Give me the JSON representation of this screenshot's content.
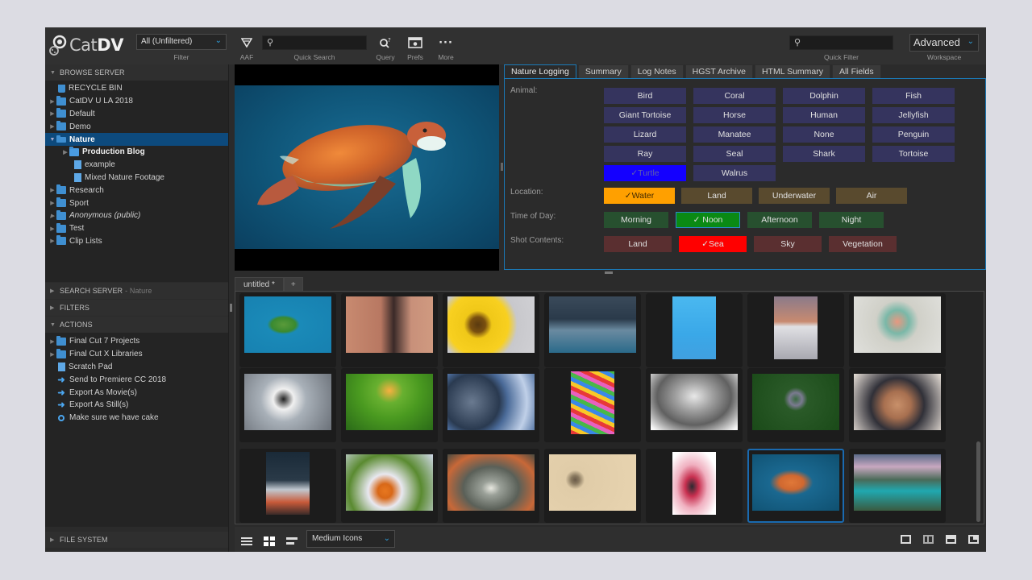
{
  "app": {
    "logo_text_light": "Cat",
    "logo_text_bold": "DV"
  },
  "toolbar": {
    "filter_value": "All (Unfiltered)",
    "filter_caption": "Filter",
    "aaf_caption": "AAF",
    "quick_search_caption": "Quick Search",
    "quick_search_value": "",
    "query_caption": "Query",
    "prefs_caption": "Prefs",
    "more_caption": "More",
    "quick_filter_caption": "Quick Filter",
    "quick_filter_value": "",
    "workspace_value": "Advanced",
    "workspace_caption": "Workspace",
    "icons": {
      "aaf": "aaf-filter-icon",
      "query": "query-search-icon",
      "prefs": "prefs-icon",
      "more": "more-ellipsis-icon"
    }
  },
  "sidebar": {
    "browse_header": "BROWSE SERVER",
    "browse_items": [
      {
        "label": "RECYCLE BIN",
        "icon": "trash",
        "level": 1,
        "expandable": false
      },
      {
        "label": "CatDV U LA 2018",
        "icon": "folder",
        "level": 0,
        "expandable": true
      },
      {
        "label": "Default",
        "icon": "folder",
        "level": 0,
        "expandable": true
      },
      {
        "label": "Demo",
        "icon": "folder",
        "level": 0,
        "expandable": true
      },
      {
        "label": "Nature",
        "icon": "folder",
        "level": 0,
        "expanded": true,
        "selected": true
      },
      {
        "label": "Production Blog",
        "icon": "catalog",
        "level": 1,
        "expandable": true,
        "bold": true
      },
      {
        "label": "example",
        "icon": "doc",
        "level": 2
      },
      {
        "label": "Mixed Nature Footage",
        "icon": "doc",
        "level": 2
      },
      {
        "label": "Research",
        "icon": "folder",
        "level": 0,
        "expandable": true
      },
      {
        "label": "Sport",
        "icon": "folder",
        "level": 0,
        "expandable": true
      },
      {
        "label": "Anonymous (public)",
        "icon": "folder",
        "level": 0,
        "expandable": true,
        "italic": true
      },
      {
        "label": "Test",
        "icon": "folder",
        "level": 0,
        "expandable": true
      },
      {
        "label": "Clip Lists",
        "icon": "folder",
        "level": 0,
        "expandable": true
      }
    ],
    "search_header": "SEARCH SERVER",
    "search_sub": "- Nature",
    "filters_header": "FILTERS",
    "actions_header": "ACTIONS",
    "action_items": [
      {
        "label": "Final Cut 7 Projects",
        "icon": "folder",
        "expandable": true
      },
      {
        "label": "Final Cut X Libraries",
        "icon": "folder",
        "expandable": true
      },
      {
        "label": "Scratch Pad",
        "icon": "doc"
      },
      {
        "label": "Send to Premiere CC 2018",
        "icon": "arrow"
      },
      {
        "label": "Export As Movie(s)",
        "icon": "arrow"
      },
      {
        "label": "Export As Still(s)",
        "icon": "arrow"
      },
      {
        "label": "Make sure we have cake",
        "icon": "gear"
      }
    ],
    "filesystem_header": "FILE SYSTEM"
  },
  "preview": {
    "subject": "sea turtle"
  },
  "logging": {
    "tabs": [
      "Nature Logging",
      "Summary",
      "Log Notes",
      "HGST Archive",
      "HTML Summary",
      "All Fields"
    ],
    "active_tab": 0,
    "fields": {
      "animal": {
        "label": "Animal:",
        "options": [
          "Bird",
          "Coral",
          "Dolphin",
          "Fish",
          "Giant Tortoise",
          "Horse",
          "Human",
          "Jellyfish",
          "Lizard",
          "Manatee",
          "None",
          "Penguin",
          "Ray",
          "Seal",
          "Shark",
          "Tortoise",
          "✓Turtle",
          "Walrus"
        ],
        "selected": "Turtle",
        "selected_color": "#1400ff"
      },
      "location": {
        "label": "Location:",
        "options": [
          "✓Water",
          "Land",
          "Underwater",
          "Air"
        ],
        "selected": "Water",
        "selected_color": "#ffa000"
      },
      "time_of_day": {
        "label": "Time of Day:",
        "options": [
          "Morning",
          "✓ Noon",
          "Afternoon",
          "Night"
        ],
        "selected": "Noon",
        "selected_color": "#0a8a14"
      },
      "shot_contents": {
        "label": "Shot Contents:",
        "options": [
          "Land",
          "✓Sea",
          "Sky",
          "Vegetation"
        ],
        "selected": "Sea",
        "selected_color": "#ff0000"
      }
    }
  },
  "grid": {
    "tabs": [
      "untitled *",
      "+"
    ],
    "thumbnails": [
      {
        "subject": "aerial island",
        "orientation": "landscape"
      },
      {
        "subject": "portrait woman",
        "orientation": "landscape"
      },
      {
        "subject": "sunflower",
        "orientation": "landscape"
      },
      {
        "subject": "city street bridge",
        "orientation": "landscape"
      },
      {
        "subject": "ferris wheel",
        "orientation": "portrait"
      },
      {
        "subject": "desert dune",
        "orientation": "portrait"
      },
      {
        "subject": "baby in water",
        "orientation": "landscape"
      },
      {
        "subject": "puffin",
        "orientation": "landscape"
      },
      {
        "subject": "green valley",
        "orientation": "landscape"
      },
      {
        "subject": "geodesic sphere",
        "orientation": "landscape"
      },
      {
        "subject": "colorful market",
        "orientation": "portrait"
      },
      {
        "subject": "frosty trees",
        "orientation": "landscape"
      },
      {
        "subject": "forest aerial",
        "orientation": "landscape"
      },
      {
        "subject": "old man hat",
        "orientation": "landscape"
      },
      {
        "subject": "night road",
        "orientation": "portrait"
      },
      {
        "subject": "butterfly flowers",
        "orientation": "landscape"
      },
      {
        "subject": "tree tunnel",
        "orientation": "landscape"
      },
      {
        "subject": "bird in grass",
        "orientation": "landscape"
      },
      {
        "subject": "smoke flare person",
        "orientation": "portrait"
      },
      {
        "subject": "sea turtle",
        "orientation": "landscape",
        "selected": true
      },
      {
        "subject": "coastal mountains",
        "orientation": "landscape"
      }
    ]
  },
  "bottombar": {
    "view_size_value": "Medium Icons",
    "view_icons": [
      "list-view-icon",
      "grid-view-icon",
      "filmstrip-view-icon"
    ],
    "layout_icons": [
      "layout-single-icon",
      "layout-split-icon",
      "layout-top-icon",
      "layout-corner-icon"
    ]
  }
}
